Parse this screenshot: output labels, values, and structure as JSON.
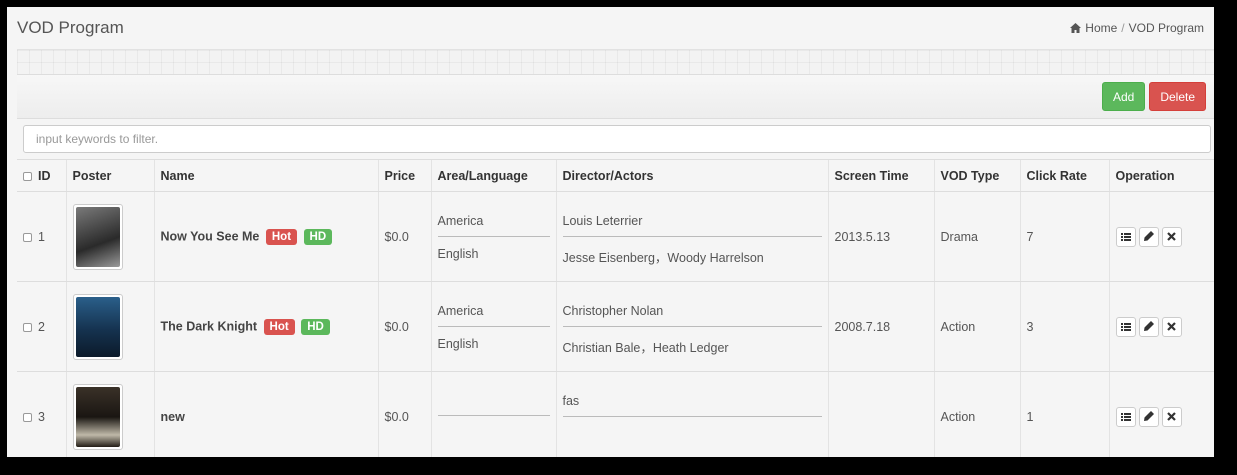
{
  "header": {
    "title": "VOD Program",
    "breadcrumb": {
      "home": "Home",
      "separator": "/",
      "current": "VOD Program"
    }
  },
  "toolbar": {
    "add_label": "Add",
    "delete_label": "Delete"
  },
  "filter": {
    "placeholder": "input keywords to filter."
  },
  "table": {
    "columns": [
      "ID",
      "Poster",
      "Name",
      "Price",
      "Area/Language",
      "Director/Actors",
      "Screen Time",
      "VOD Type",
      "Click Rate",
      "Operation"
    ],
    "rows": [
      {
        "id": "1",
        "name": "Now You See Me",
        "hot": "Hot",
        "hd": "HD",
        "price": "$0.0",
        "area": "America",
        "language": "English",
        "director": "Louis Leterrier",
        "actors": "Jesse Eisenberg，Woody Harrelson",
        "screen_time": "2013.5.13",
        "vod_type": "Drama",
        "click_rate": "7"
      },
      {
        "id": "2",
        "name": "The Dark Knight",
        "hot": "Hot",
        "hd": "HD",
        "price": "$0.0",
        "area": "America",
        "language": "English",
        "director": "Christopher Nolan",
        "actors": "Christian Bale，Heath Ledger",
        "screen_time": "2008.7.18",
        "vod_type": "Action",
        "click_rate": "3"
      },
      {
        "id": "3",
        "name": "new",
        "price": "$0.0",
        "area": "",
        "language": "",
        "director": "fas",
        "actors": "",
        "screen_time": "",
        "vod_type": "Action",
        "click_rate": "1"
      }
    ]
  },
  "icons": {
    "home": "home-icon",
    "list": "list-icon",
    "edit": "pencil-icon",
    "remove": "close-icon"
  },
  "colors": {
    "add": "#5cb85c",
    "delete": "#d9534f",
    "hot": "#d9534f",
    "hd": "#5cb85c"
  }
}
